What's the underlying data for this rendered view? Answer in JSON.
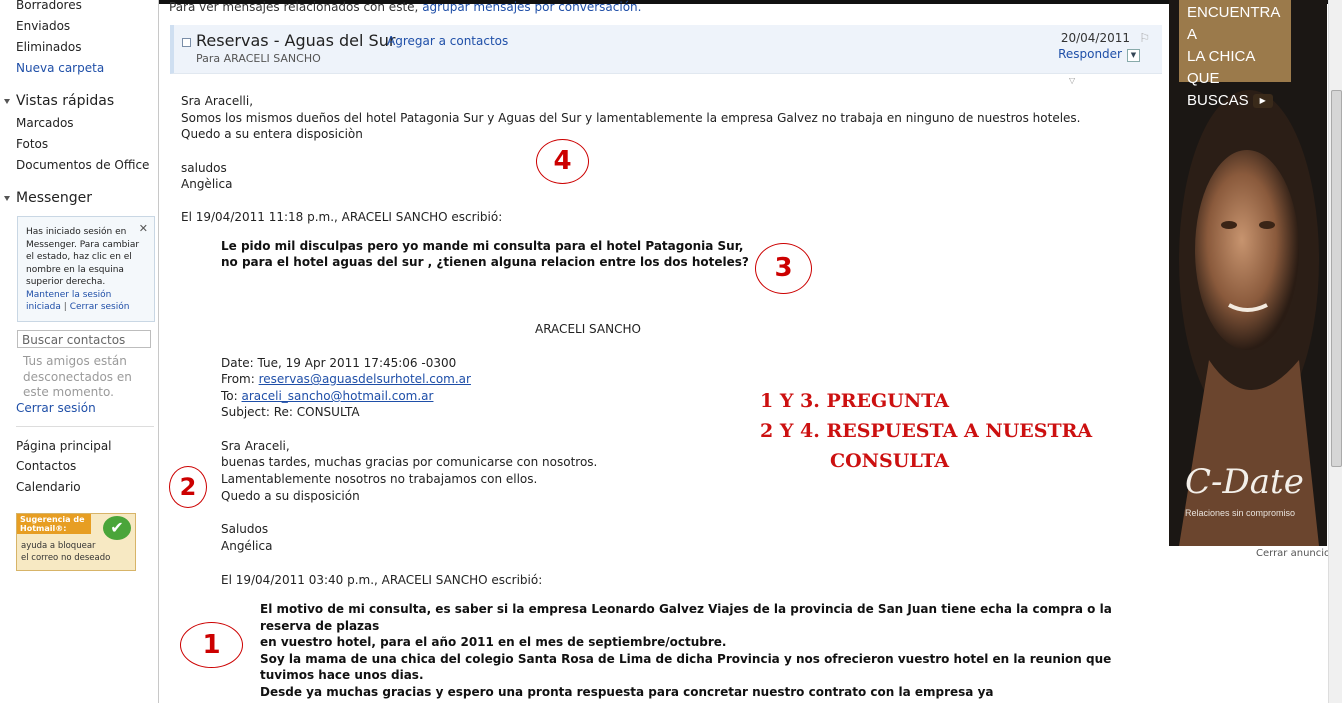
{
  "sidebar": {
    "folders": [
      "Borradores",
      "Enviados",
      "Eliminados"
    ],
    "new_folder": "Nueva carpeta",
    "quick_views_header": "Vistas rápidas",
    "quick_views": [
      "Marcados",
      "Fotos",
      "Documentos de Office"
    ],
    "messenger_header": "Messenger",
    "messenger_notice": "Has iniciado sesión en Messenger. Para cambiar el estado, haz clic en el nombre en la esquina superior derecha.",
    "keep_session": "Mantener la sesión iniciada",
    "close_session_inline": "Cerrar sesión",
    "search_placeholder": "Buscar contactos",
    "offline_text": "Tus amigos están desconectados en este momento.",
    "sign_out": "Cerrar sesión",
    "nav": [
      "Página principal",
      "Contactos",
      "Calendario"
    ],
    "tip_header": "Sugerencia de Hotmail®:",
    "tip_body_1": "ayuda a bloquear",
    "tip_body_2": "el correo no deseado"
  },
  "main": {
    "related_text": "Para ver mensajes relacionados con este,",
    "related_link": "agrupar mensajes por conversación.",
    "subject": "Reservas - Aguas del Sur",
    "add_contacts": "Agregar a contactos",
    "to_line": "Para ARACELI SANCHO",
    "date": "20/04/2011",
    "reply": "Responder"
  },
  "reply": {
    "greeting": "Sra Aracelli,",
    "line1": "Somos los mismos dueños del hotel Patagonia Sur y Aguas del Sur y lamentablemente la empresa Galvez no trabaja en ninguno de nuestros hoteles.",
    "line2": "Quedo a su entera disposiciòn",
    "closing": "saludos",
    "signature": "Angèlica",
    "quote_header": "El 19/04/2011 11:18 p.m., ARACELI SANCHO escribió:"
  },
  "question2": {
    "line1": "Le pido mil disculpas pero yo mande mi consulta para el hotel Patagonia Sur,",
    "line2": "no para el hotel aguas del sur , ¿tienen alguna relacion entre los dos hoteles?",
    "sender_name": "ARACELI SANCHO",
    "date_line": "Date: Tue, 19 Apr 2011 17:45:06 -0300",
    "from_label": "From:",
    "from_email": "reservas@aguasdelsurhotel.com.ar",
    "to_label": "To:",
    "to_email": "araceli_sancho@hotmail.com.ar",
    "subject_line": "Subject: Re: CONSULTA"
  },
  "reply1": {
    "greeting": "Sra Araceli,",
    "line1": "buenas tardes, muchas gracias por comunicarse con nosotros.",
    "line2": "Lamentablemente nosotros no trabajamos con ellos.",
    "line3": "Quedo a su disposición",
    "closing": "Saludos",
    "signature": "Angélica",
    "quote_header": "El 19/04/2011 03:40 p.m., ARACELI SANCHO escribió:"
  },
  "question1": {
    "line1": "El motivo de mi consulta, es saber si la empresa Leonardo Galvez Viajes de la provincia de San Juan tiene echa la compra o la",
    "line2": "reserva de plazas",
    "line3": "en vuestro hotel, para el año 2011 en el mes de septiembre/octubre.",
    "line4": "Soy la mama de una chica del colegio Santa Rosa de Lima  de dicha Provincia y nos ofrecieron vuestro hotel en la reunion que",
    "line5": "tuvimos hace unos dias.",
    "line6": "Desde ya muchas gracias y espero una pronta respuesta para concretar nuestro contrato con la empresa ya"
  },
  "annotations": {
    "circles": [
      "4",
      "3",
      "2",
      "1"
    ],
    "legend1": "1 Y 3. PREGUNTA",
    "legend2": "2 Y 4. RESPUESTA A NUESTRA",
    "legend3": "CONSULTA"
  },
  "ad": {
    "headline_1": "ENCUENTRA A",
    "headline_2": "LA CHICA QUE",
    "headline_3": "BUSCAS",
    "brand": "C-Date",
    "tagline": "Relaciones sin compromiso",
    "close": "Cerrar anuncio"
  },
  "colors": {
    "accent_link": "#1f4fa8",
    "annotation_red": "#cc1010",
    "header_bg": "#eef3fa"
  }
}
